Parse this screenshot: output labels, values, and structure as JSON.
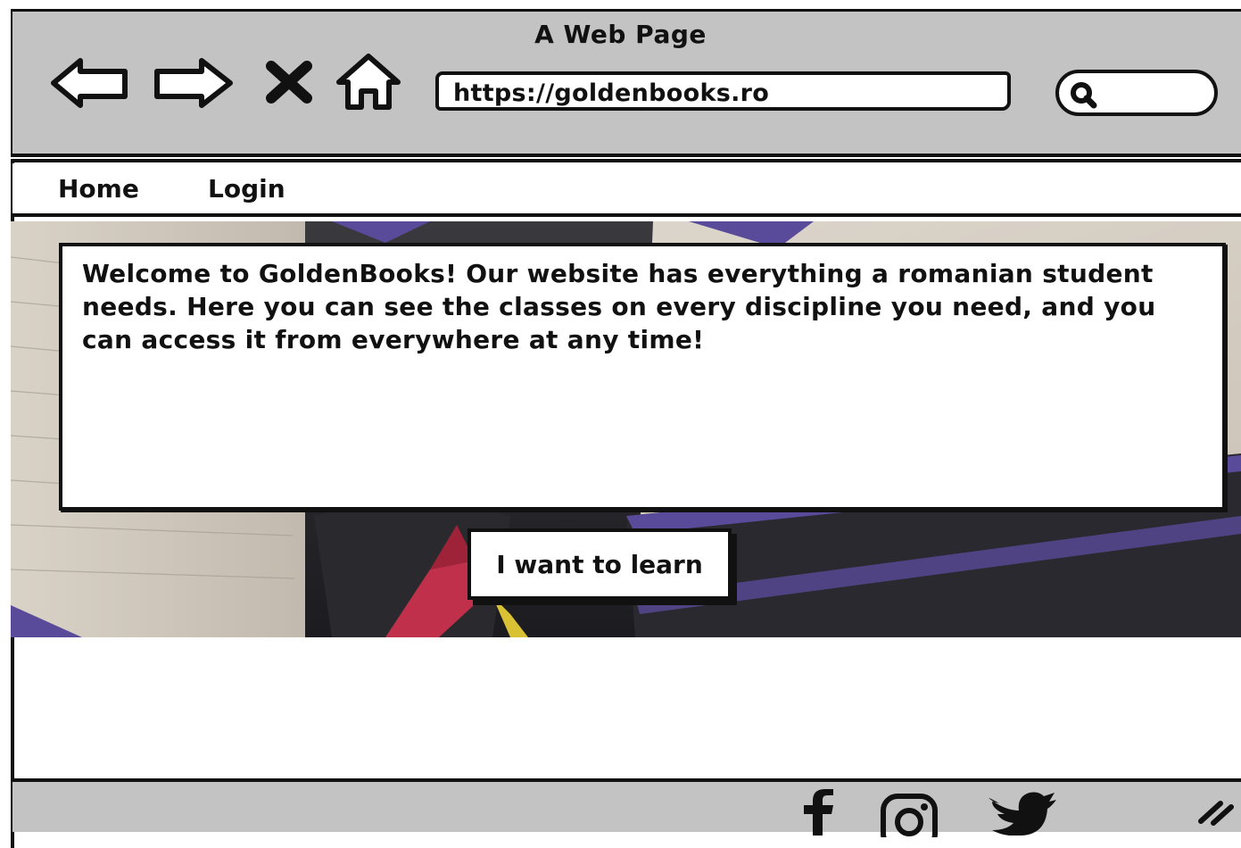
{
  "window": {
    "title": "A Web Page",
    "url": "https://goldenbooks.ro"
  },
  "toolbar": {
    "icons": [
      "back-arrow-icon",
      "forward-arrow-icon",
      "close-icon",
      "home-icon",
      "search-icon"
    ]
  },
  "nav": {
    "items": [
      {
        "label": "Home"
      },
      {
        "label": "Login"
      }
    ]
  },
  "hero": {
    "welcome_text": "Welcome to GoldenBooks! Our website has everything a romanian student needs. Here you can see the classes on every discipline you need, and you can access it from everywhere at any time!",
    "cta_label": "I want to learn"
  },
  "footer": {
    "social_icons": [
      "facebook-icon",
      "instagram-icon",
      "twitter-icon"
    ]
  },
  "colors": {
    "chrome_gray": "#c3c3c3",
    "ink": "#111111",
    "book_purple": "#5a4a9a",
    "book_red": "#c0304a"
  }
}
